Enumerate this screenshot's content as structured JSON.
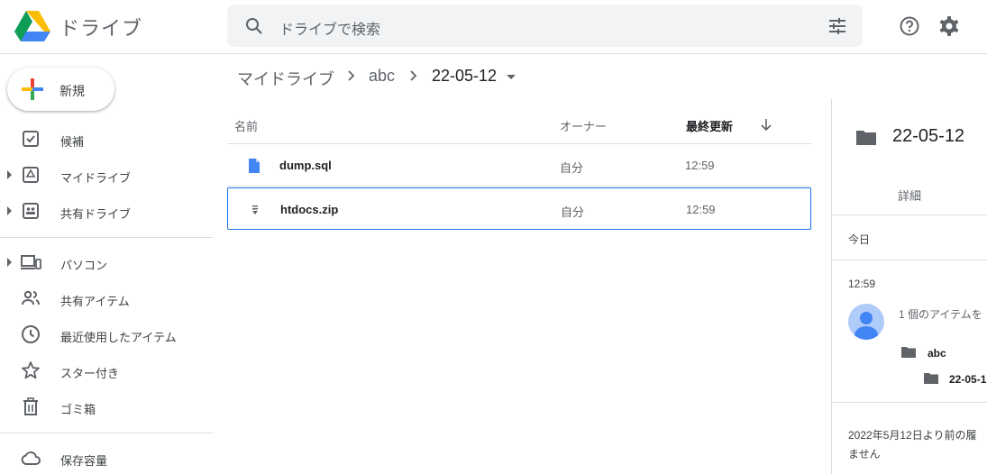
{
  "app": {
    "name": "ドライブ"
  },
  "search": {
    "placeholder": "ドライブで検索"
  },
  "sidebar": {
    "new_label": "新規",
    "items": [
      {
        "label": "候補"
      },
      {
        "label": "マイドライブ"
      },
      {
        "label": "共有ドライブ"
      },
      {
        "label": "パソコン"
      },
      {
        "label": "共有アイテム"
      },
      {
        "label": "最近使用したアイテム"
      },
      {
        "label": "スター付き"
      },
      {
        "label": "ゴミ箱"
      },
      {
        "label": "保存容量"
      }
    ]
  },
  "breadcrumb": {
    "root": "マイドライブ",
    "parent": "abc",
    "current": "22-05-12"
  },
  "list": {
    "columns": {
      "name": "名前",
      "owner": "オーナー",
      "modified": "最終更新"
    },
    "rows": [
      {
        "name": "dump.sql",
        "owner": "自分",
        "modified": "12:59"
      },
      {
        "name": "htdocs.zip",
        "owner": "自分",
        "modified": "12:59"
      }
    ]
  },
  "details": {
    "title": "22-05-12",
    "tab": "詳細",
    "today": "今日",
    "time": "12:59",
    "activity": "1 個のアイテムを",
    "folder1": "abc",
    "folder2": "22-05-1",
    "history_line1": "2022年5月12日より前の履",
    "history_line2": "ません"
  },
  "colors": {
    "accent": "#1a73e8",
    "icon_gray": "#5f6368",
    "sql_blue": "#4285f4"
  }
}
